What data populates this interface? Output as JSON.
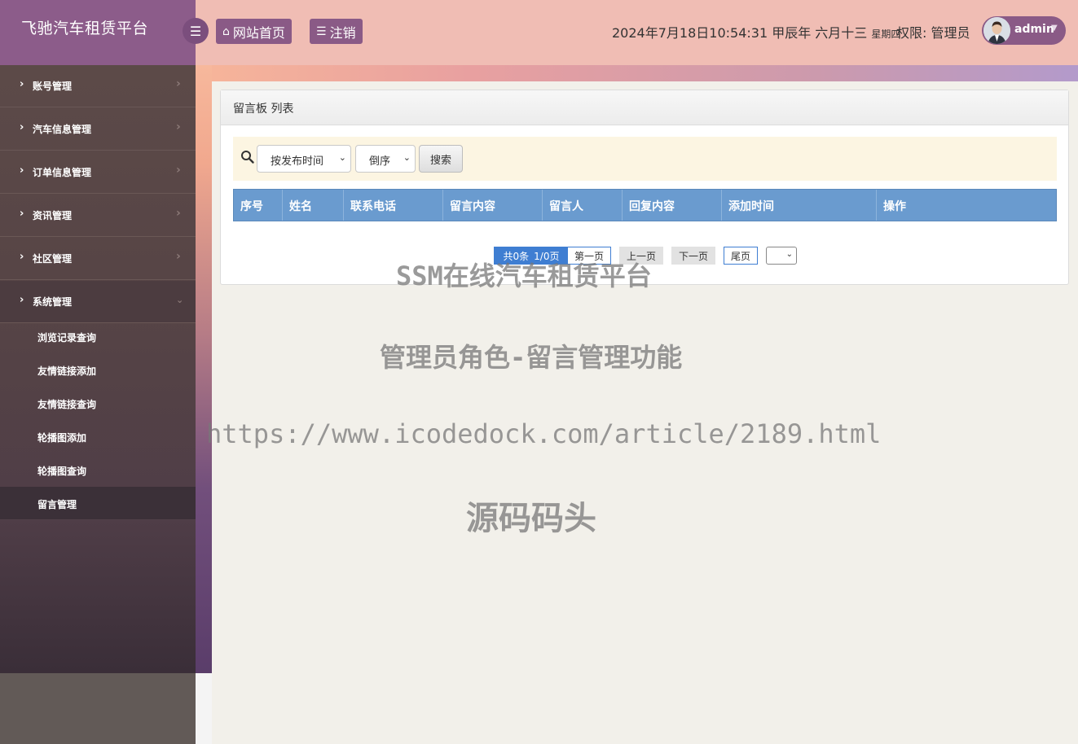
{
  "header": {
    "brand_title": "飞驰汽车租赁平台",
    "home_label": "网站首页",
    "logout_label": "注销",
    "datetime": "2024年7月18日10:54:31 甲辰年 六月十三",
    "weekday": "星期四",
    "permission": "权限: 管理员",
    "username": "admin"
  },
  "sidebar": {
    "items": [
      {
        "label": "账号管理"
      },
      {
        "label": "汽车信息管理"
      },
      {
        "label": "订单信息管理"
      },
      {
        "label": "资讯管理"
      },
      {
        "label": "社区管理"
      },
      {
        "label": "系统管理"
      }
    ],
    "sub_items": [
      {
        "label": "浏览记录查询"
      },
      {
        "label": "友情链接添加"
      },
      {
        "label": "友情链接查询"
      },
      {
        "label": "轮播图添加"
      },
      {
        "label": "轮播图查询"
      },
      {
        "label": "留言管理"
      }
    ]
  },
  "panel": {
    "title": "留言板 列表",
    "sort_field": "按发布时间",
    "sort_order": "倒序",
    "search_label": "搜索",
    "columns": [
      "序号",
      "姓名",
      "联系电话",
      "留言内容",
      "留言人",
      "回复内容",
      "添加时间",
      "操作"
    ]
  },
  "pager": {
    "total": "共0条",
    "page": "1/0页",
    "first": "第一页",
    "prev": "上一页",
    "next": "下一页",
    "last": "尾页"
  },
  "watermarks": {
    "line1": "SSM在线汽车租赁平台",
    "line2": "管理员角色-留言管理功能",
    "line3": "https://www.icodedock.com/article/2189.html",
    "line4": "源码码头"
  },
  "colors": {
    "header_bg": "#f0bdb4",
    "brand_bg": "#8c5c8a",
    "table_head": "#6a9bcf",
    "pager_accent": "#3f7ed2"
  }
}
